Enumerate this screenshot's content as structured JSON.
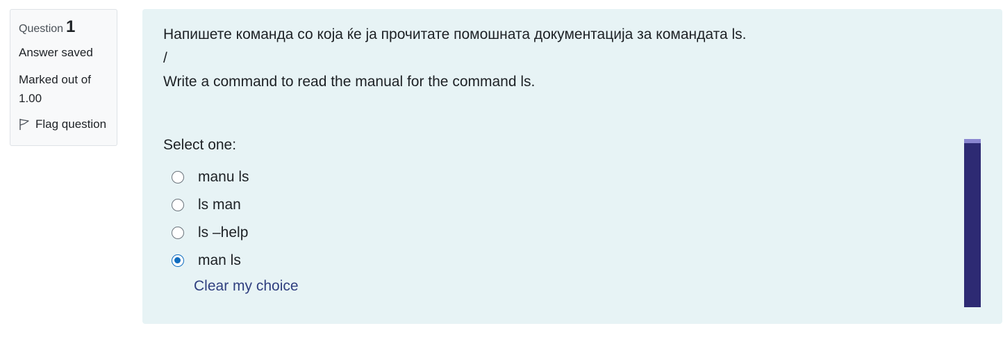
{
  "info": {
    "question_label": "Question",
    "question_number": "1",
    "state": "Answer saved",
    "grade": "Marked out of 1.00",
    "flag_label": "Flag question"
  },
  "question": {
    "text_mk": "Напишете команда со која ќе ја прочитате помошната документација за командата ls.",
    "separator": "/",
    "text_en": "Write a command to read the manual for the command ls.",
    "prompt": "Select one:",
    "options": [
      {
        "label": "manu ls",
        "checked": false
      },
      {
        "label": "ls man",
        "checked": false
      },
      {
        "label": "ls –help",
        "checked": false
      },
      {
        "label": "man ls",
        "checked": true
      }
    ],
    "clear_label": "Clear my choice"
  },
  "colors": {
    "accent": "#0f6cbf",
    "link": "#2f3f7f",
    "content_bg": "#e7f3f5",
    "scrollbar": "#2d2a73"
  }
}
